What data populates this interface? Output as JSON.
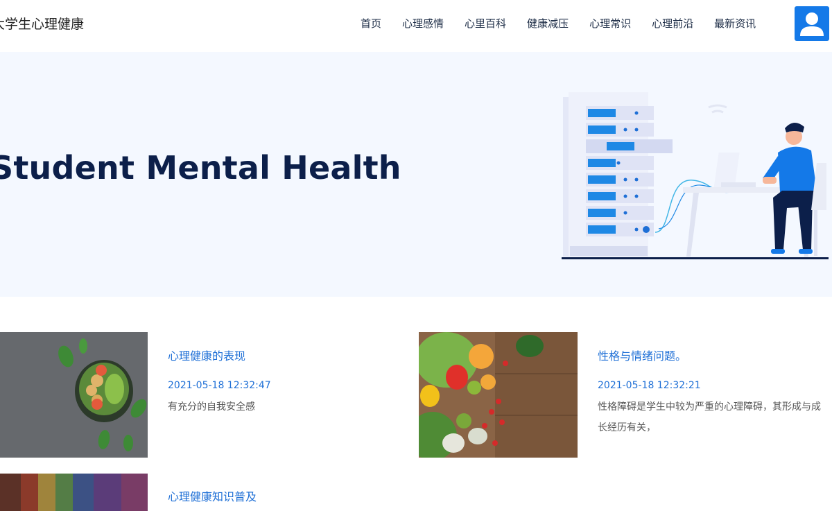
{
  "site": {
    "title": "大学生心理健康"
  },
  "nav": {
    "items": [
      {
        "label": "首页"
      },
      {
        "label": "心理感情"
      },
      {
        "label": "心里百科"
      },
      {
        "label": "健康减压"
      },
      {
        "label": "心理常识"
      },
      {
        "label": "心理前沿"
      },
      {
        "label": "最新资讯"
      }
    ]
  },
  "hero": {
    "title": "Student Mental Health"
  },
  "articles": [
    {
      "title": "心理健康的表现",
      "date": "2021-05-18 12:32:47",
      "summary": "有充分的自我安全感"
    },
    {
      "title": "性格与情绪问题。",
      "date": "2021-05-18 12:32:21",
      "summary": "性格障碍是学生中较为严重的心理障碍，其形成与成长经历有关，"
    },
    {
      "title": "心理健康知识普及",
      "date": "",
      "summary": ""
    }
  ],
  "colors": {
    "accent": "#1479e8",
    "link": "#1e6fd6",
    "heroBg": "#f4f8ff",
    "heroText": "#0c1f4a"
  },
  "icons": {
    "avatar": "user-icon"
  }
}
